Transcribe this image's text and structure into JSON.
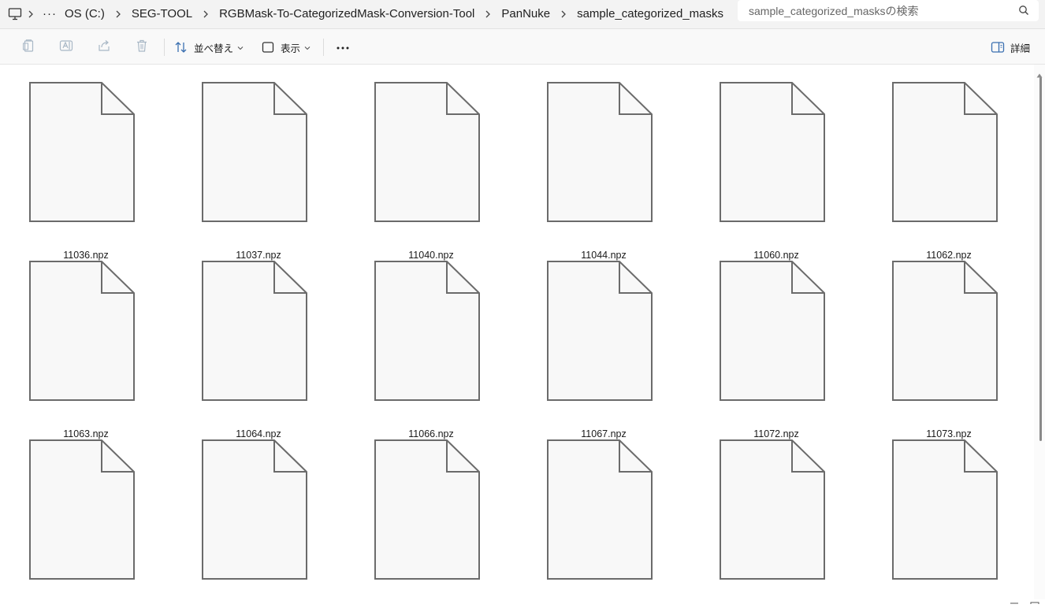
{
  "address_bar": {
    "crumbs": [
      {
        "label": "···"
      },
      {
        "label": "OS (C:)"
      },
      {
        "label": "SEG-TOOL"
      },
      {
        "label": "RGBMask-To-CategorizedMask-Conversion-Tool"
      },
      {
        "label": "PanNuke"
      },
      {
        "label": "sample_categorized_masks"
      }
    ],
    "search_placeholder": "sample_categorized_masksの検索"
  },
  "toolbar": {
    "sort_label": "並べ替え",
    "view_label": "表示",
    "more_label": "···",
    "details_label": "詳細",
    "icons": [
      "copy-icon",
      "rename-icon",
      "share-icon",
      "delete-icon",
      "sort-icon",
      "view-icon",
      "more-icon",
      "details-pane-icon"
    ]
  },
  "colors": {
    "icon_stroke": "#6b6b6b",
    "icon_fill": "#f8f8f8",
    "address_bg": "#f3f3f3"
  },
  "files": [
    {
      "name": "11036.npz"
    },
    {
      "name": "11037.npz"
    },
    {
      "name": "11040.npz"
    },
    {
      "name": "11044.npz"
    },
    {
      "name": "11060.npz"
    },
    {
      "name": "11062.npz"
    },
    {
      "name": "11063.npz"
    },
    {
      "name": "11064.npz"
    },
    {
      "name": "11066.npz"
    },
    {
      "name": "11067.npz"
    },
    {
      "name": "11072.npz"
    },
    {
      "name": "11073.npz"
    },
    {
      "name": ""
    },
    {
      "name": ""
    },
    {
      "name": ""
    },
    {
      "name": ""
    },
    {
      "name": ""
    },
    {
      "name": ""
    }
  ]
}
